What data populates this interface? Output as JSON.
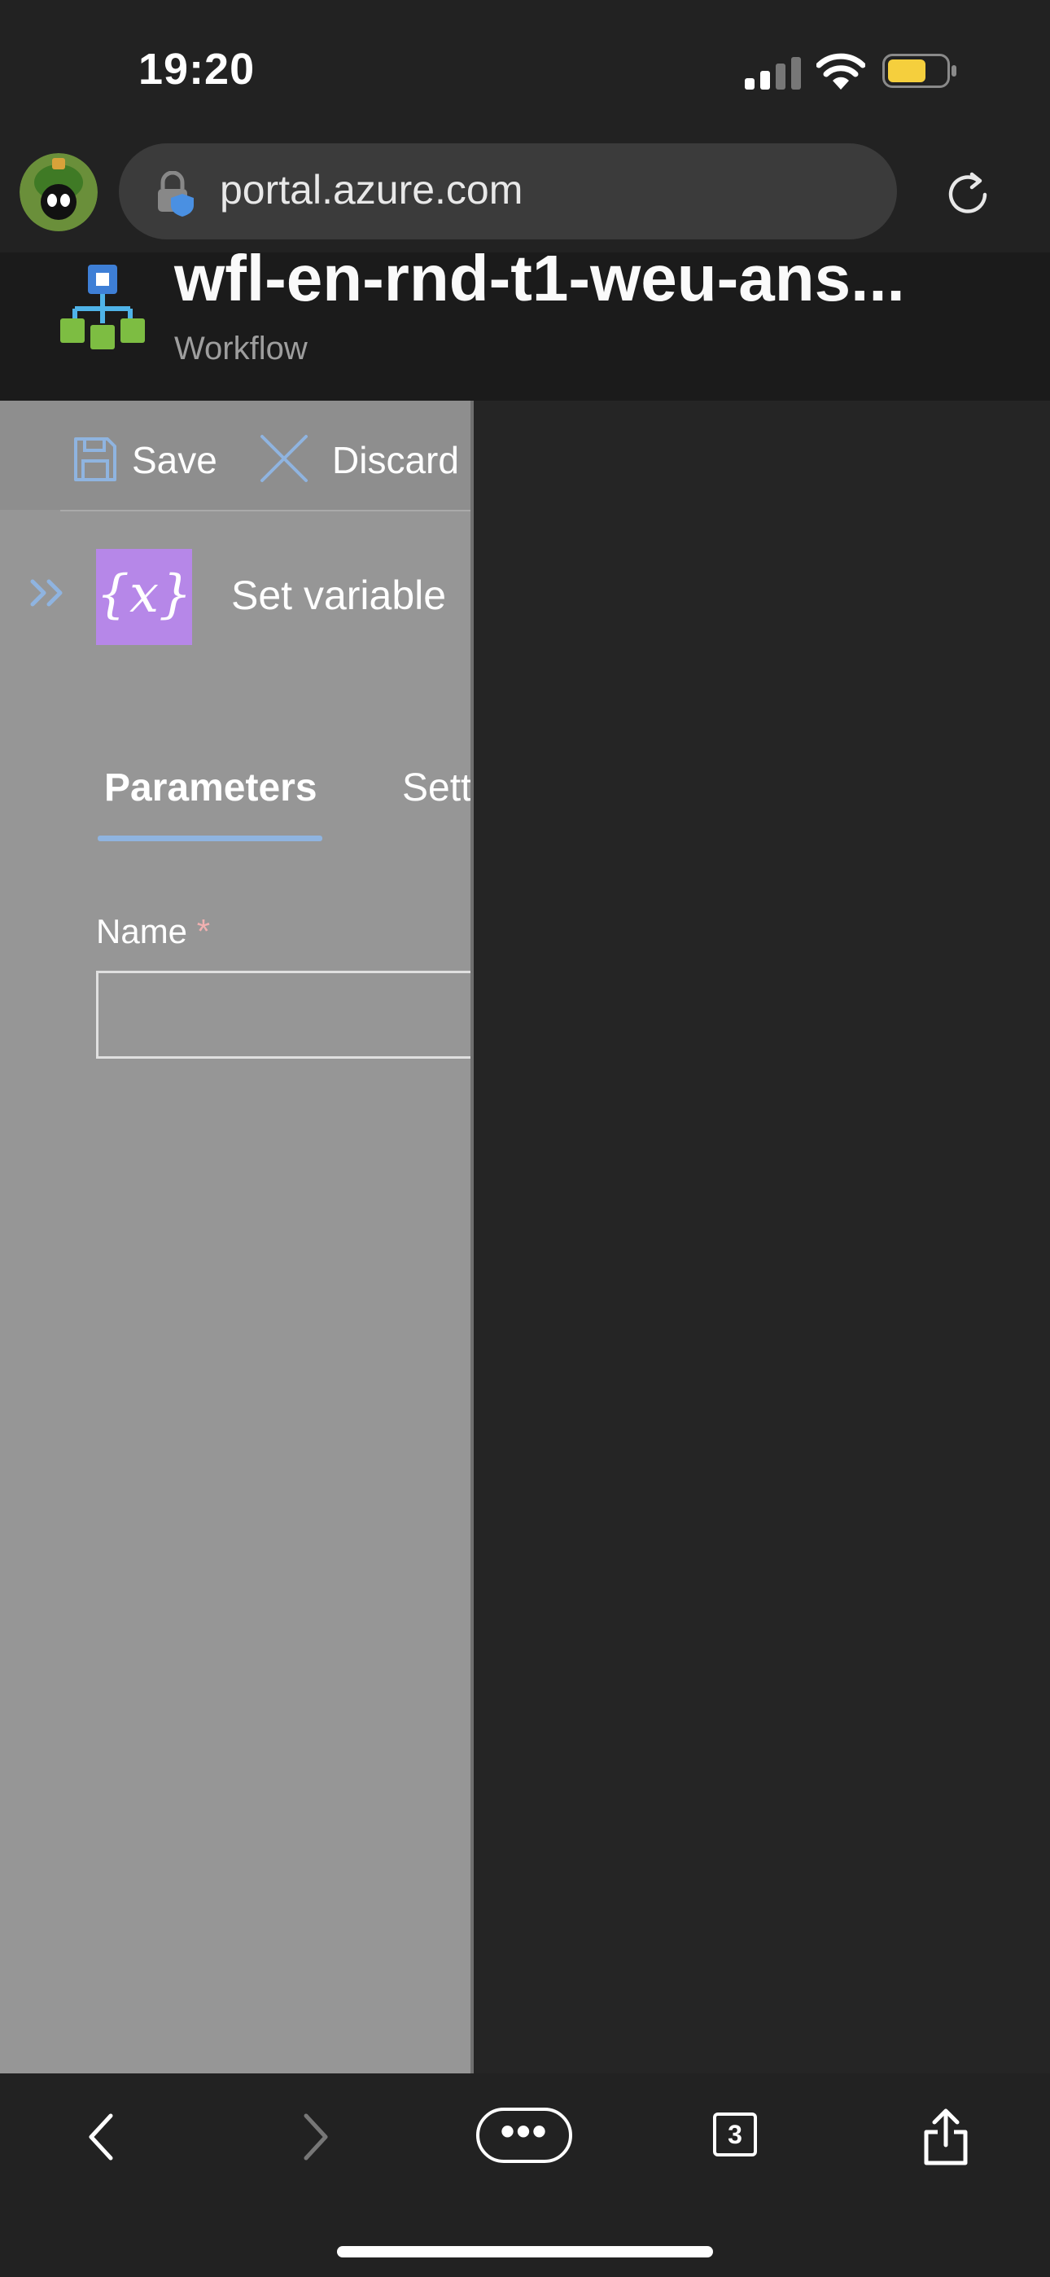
{
  "status_bar": {
    "time": "19:20"
  },
  "browser": {
    "url": "portal.azure.com",
    "open_tabs": "3"
  },
  "header": {
    "title": "wfl-en-rnd-t1-weu-ans...",
    "subtitle": "Workflow"
  },
  "toolbar": {
    "save_label": "Save",
    "discard_label": "Discard"
  },
  "action": {
    "icon_text": "{x}",
    "title": "Set variable"
  },
  "tabs": [
    {
      "label": "Parameters"
    },
    {
      "label": "Sett"
    }
  ],
  "form": {
    "name_label": "Name",
    "required_mark": "*",
    "name_value": ""
  },
  "colors": {
    "action_accent": "#b687e8",
    "tab_underline": "#8fb4e0",
    "link_blue": "#8fb4e0"
  }
}
